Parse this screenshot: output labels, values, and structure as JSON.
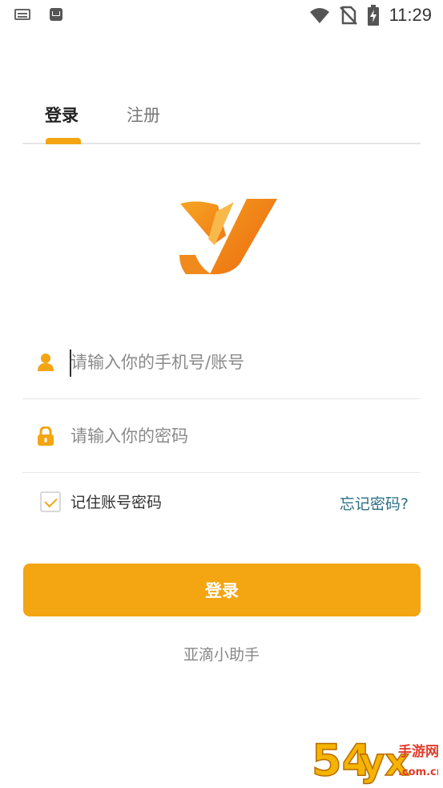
{
  "status_bar": {
    "time": "11:29",
    "left_icons": [
      "keyboard-icon",
      "mail-icon"
    ],
    "right_icons": [
      "wifi-icon",
      "no-sim-icon",
      "battery-charging-icon"
    ]
  },
  "tabs": [
    {
      "label": "登录",
      "active": true
    },
    {
      "label": "注册",
      "active": false
    }
  ],
  "login_form": {
    "account_placeholder": "请输入你的手机号/账号",
    "password_placeholder": "请输入你的密码",
    "remember_label": "记住账号密码",
    "remember_checked": true,
    "forgot_label": "忘记密码?",
    "submit_label": "登录"
  },
  "footer": {
    "app_name": "亚滴小助手"
  },
  "watermark": {
    "text": "54yx手游网 .com.cn"
  },
  "colors": {
    "accent": "#f3a512",
    "link": "#2b6f86",
    "logo_orange": "#f08a1c"
  }
}
